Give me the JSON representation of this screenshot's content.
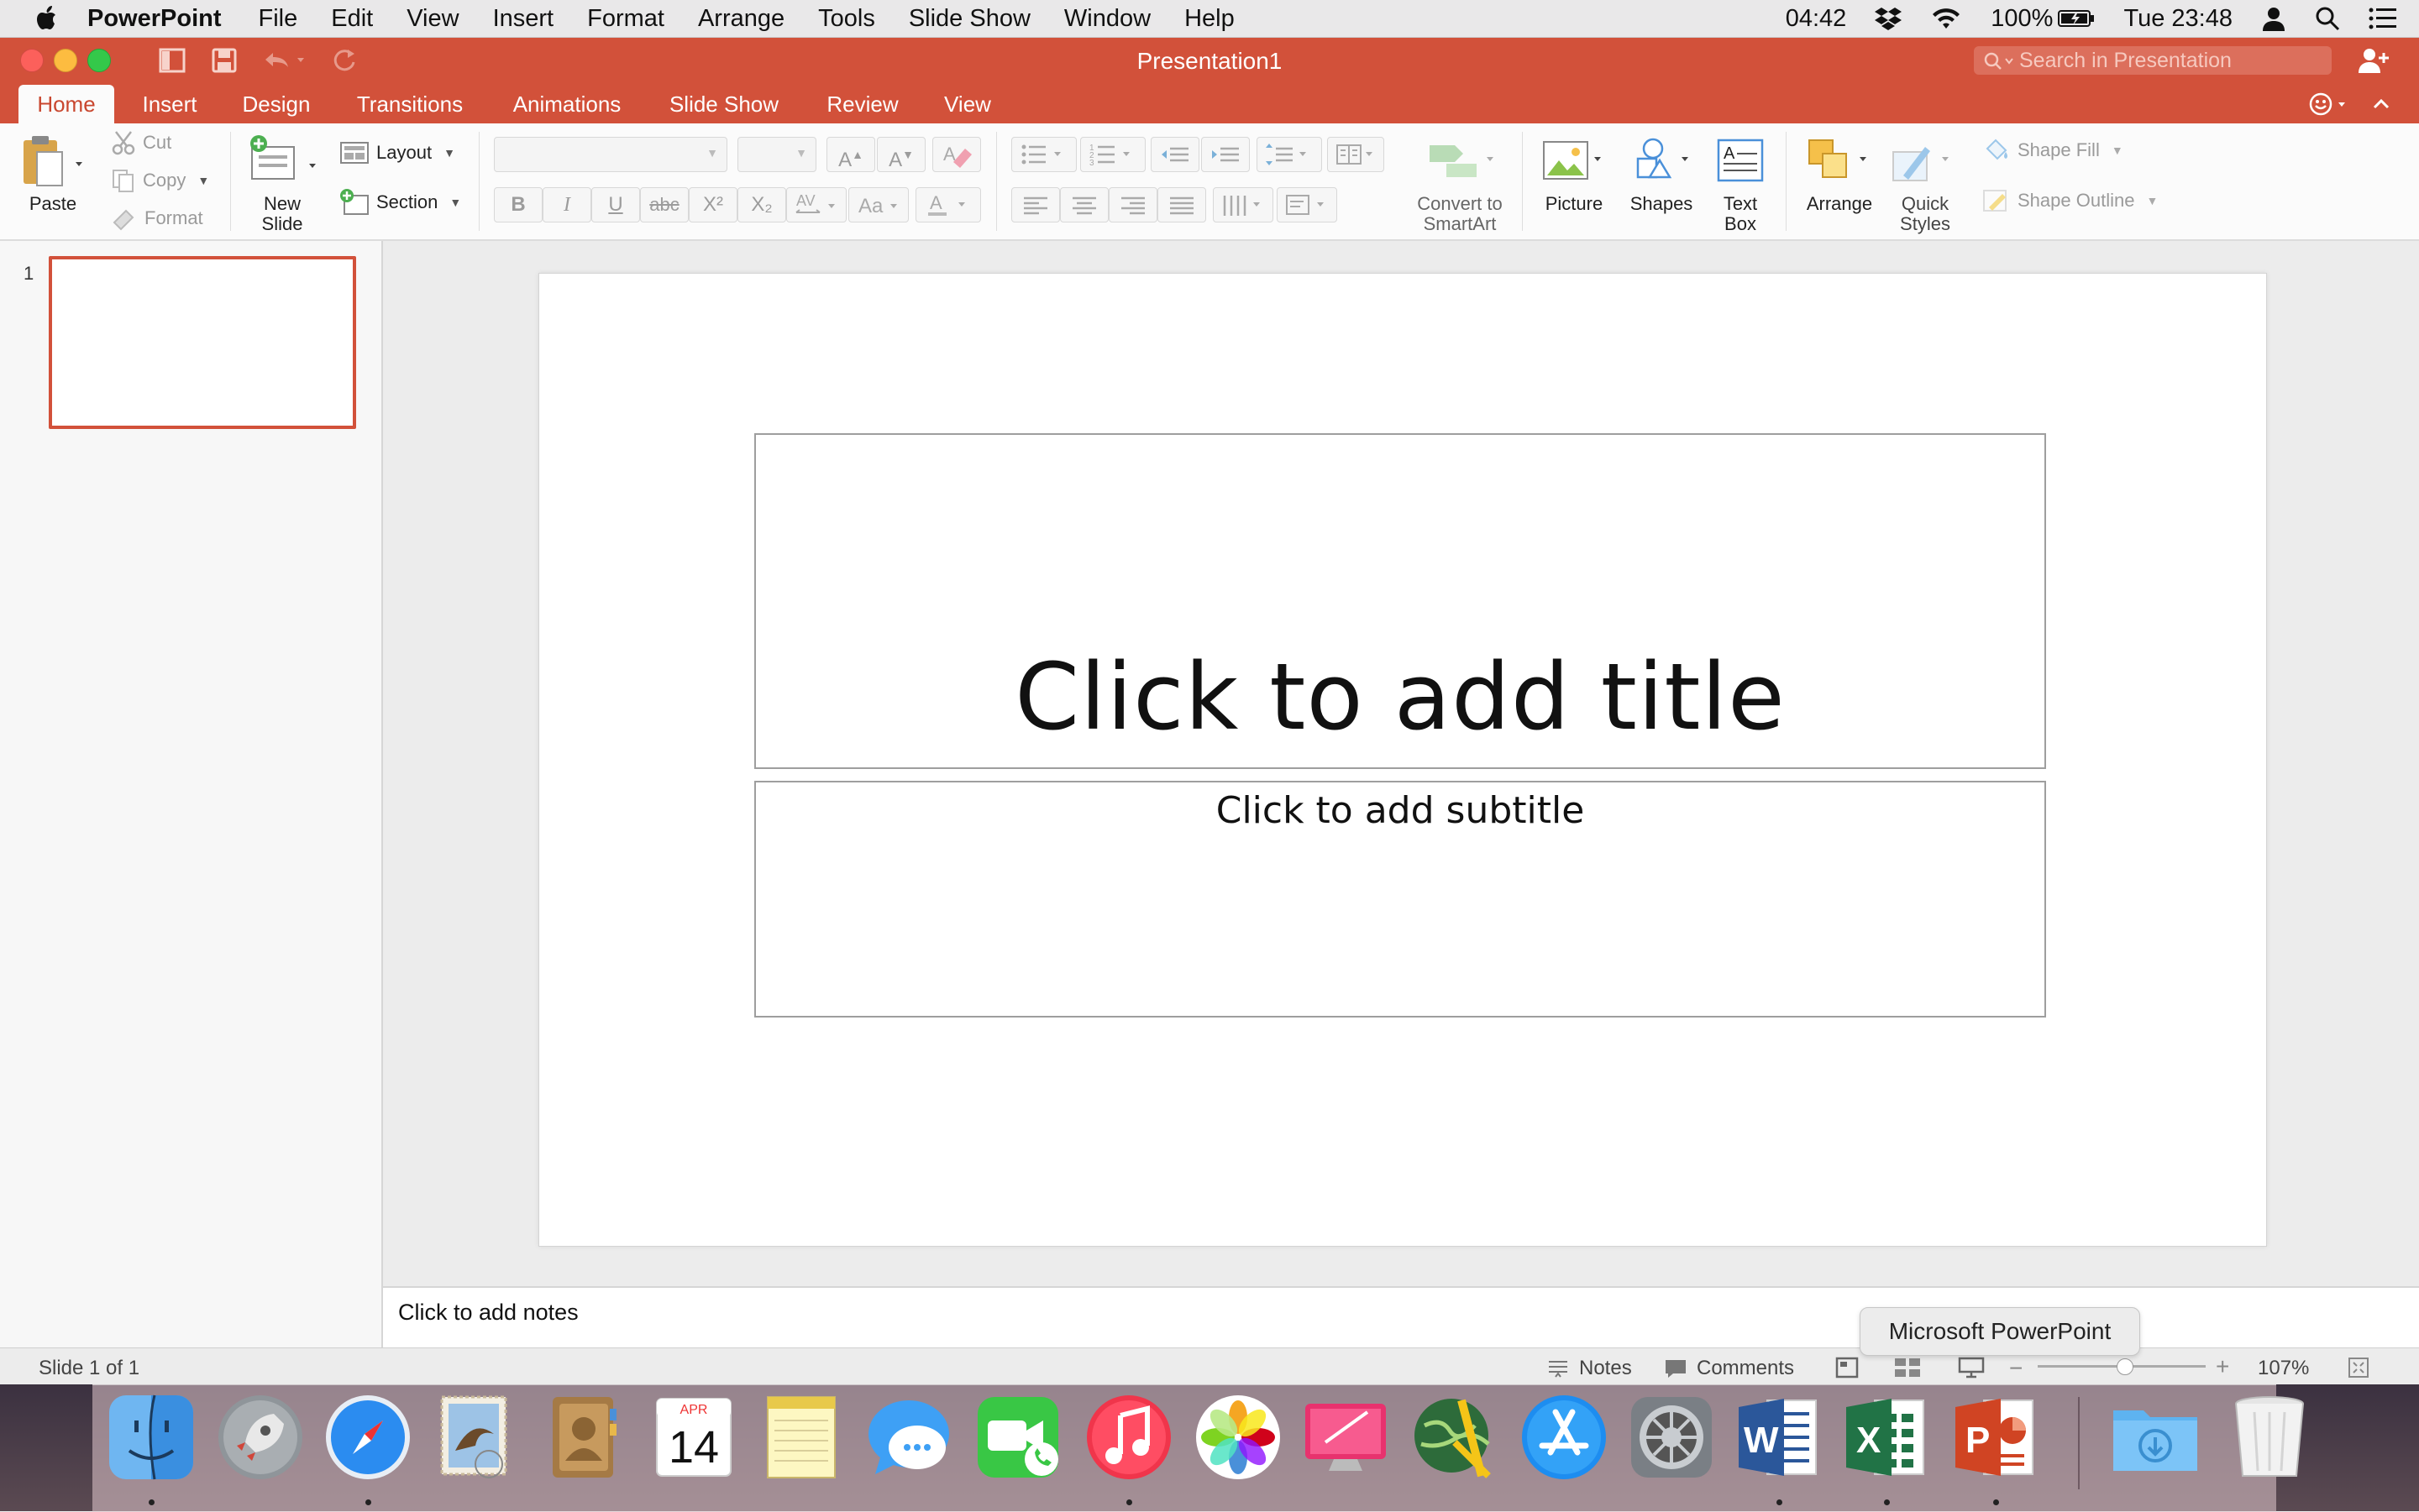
{
  "menubar": {
    "app_name": "PowerPoint",
    "items": [
      "File",
      "Edit",
      "View",
      "Insert",
      "Format",
      "Arrange",
      "Tools",
      "Slide Show",
      "Window",
      "Help"
    ],
    "clock_left": "04:42",
    "battery": "100%",
    "datetime": "Tue 23:48"
  },
  "window": {
    "title": "Presentation1",
    "search_placeholder": "Search in Presentation"
  },
  "tabs": [
    "Home",
    "Insert",
    "Design",
    "Transitions",
    "Animations",
    "Slide Show",
    "Review",
    "View"
  ],
  "ribbon": {
    "paste": "Paste",
    "cut": "Cut",
    "copy": "Copy",
    "format": "Format",
    "new_slide_1": "New",
    "new_slide_2": "Slide",
    "layout": "Layout",
    "section": "Section",
    "convert_1": "Convert to",
    "convert_2": "SmartArt",
    "picture": "Picture",
    "shapes": "Shapes",
    "textbox_1": "Text",
    "textbox_2": "Box",
    "arrange": "Arrange",
    "quick_1": "Quick",
    "quick_2": "Styles",
    "shape_fill": "Shape Fill",
    "shape_outline": "Shape Outline",
    "font_buttons": [
      "B",
      "I",
      "U",
      "abc",
      "X²",
      "X₂"
    ]
  },
  "slides_panel": {
    "slide_number": "1"
  },
  "slide": {
    "title_placeholder": "Click to add title",
    "subtitle_placeholder": "Click to add subtitle"
  },
  "notes": {
    "placeholder": "Click to add notes"
  },
  "status": {
    "slide_counter": "Slide 1 of 1",
    "notes_label": "Notes",
    "comments_label": "Comments",
    "zoom": "107%"
  },
  "tooltip": "Microsoft PowerPoint",
  "calendar_icon": {
    "month": "APR",
    "day": "14"
  },
  "dock_icons": [
    "finder-icon",
    "launchpad-icon",
    "safari-icon",
    "mail-icon",
    "contacts-icon",
    "calendar-icon",
    "notes-icon",
    "messages-icon",
    "facetime-icon",
    "itunes-icon",
    "photos-icon",
    "cleanmymac-icon",
    "globe-app-icon",
    "app-store-icon",
    "system-preferences-icon",
    "word-icon",
    "excel-icon",
    "powerpoint-icon",
    "downloads-folder-icon",
    "trash-icon"
  ],
  "colors": {
    "accent": "#d2513a",
    "active_tab_text": "#c9472f",
    "close": "#fc605b",
    "minimize": "#fdbc40",
    "zoom": "#34c84a"
  }
}
